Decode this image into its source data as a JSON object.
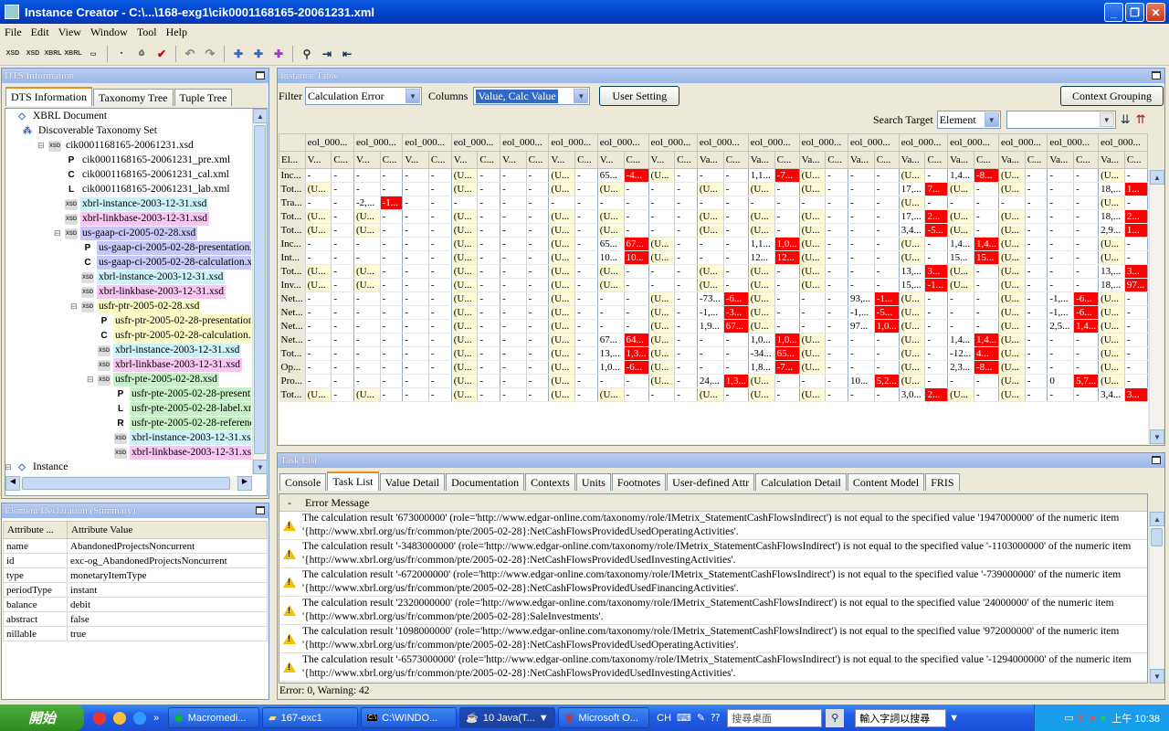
{
  "window": {
    "title": "Instance Creator - C:\\...\\168-exg1\\cik0001168165-20061231.xml"
  },
  "menu": [
    "File",
    "Edit",
    "View",
    "Window",
    "Tool",
    "Help"
  ],
  "dts": {
    "title": "DTS Information",
    "tabs": [
      "DTS Information",
      "Taxonomy Tree",
      "Tuple Tree"
    ],
    "tree": [
      {
        "label": "XBRL Document",
        "indent": 0,
        "icon": "X",
        "hl": ""
      },
      {
        "label": "Discoverable Taxonomy Set",
        "indent": 1,
        "icon": "T",
        "hl": ""
      },
      {
        "label": "cik0001168165-20061231.xsd",
        "indent": 2,
        "icon": "xsd",
        "hl": ""
      },
      {
        "label": "cik0001168165-20061231_pre.xml",
        "indent": 3,
        "icon": "P",
        "hl": ""
      },
      {
        "label": "cik0001168165-20061231_cal.xml",
        "indent": 3,
        "icon": "C",
        "hl": ""
      },
      {
        "label": "cik0001168165-20061231_lab.xml",
        "indent": 3,
        "icon": "L",
        "hl": ""
      },
      {
        "label": "xbrl-instance-2003-12-31.xsd",
        "indent": 3,
        "icon": "xsd",
        "hl": "cyan"
      },
      {
        "label": "xbrl-linkbase-2003-12-31.xsd",
        "indent": 3,
        "icon": "xsd",
        "hl": "pink"
      },
      {
        "label": "us-gaap-ci-2005-02-28.xsd",
        "indent": 3,
        "icon": "xsd",
        "hl": "blue"
      },
      {
        "label": "us-gaap-ci-2005-02-28-presentation.x",
        "indent": 4,
        "icon": "P",
        "hl": "blue"
      },
      {
        "label": "us-gaap-ci-2005-02-28-calculation.xr",
        "indent": 4,
        "icon": "C",
        "hl": "blue"
      },
      {
        "label": "xbrl-instance-2003-12-31.xsd",
        "indent": 4,
        "icon": "xsd",
        "hl": "cyan"
      },
      {
        "label": "xbrl-linkbase-2003-12-31.xsd",
        "indent": 4,
        "icon": "xsd",
        "hl": "pink"
      },
      {
        "label": "usfr-ptr-2005-02-28.xsd",
        "indent": 4,
        "icon": "xsd",
        "hl": "yellow"
      },
      {
        "label": "usfr-ptr-2005-02-28-presentation",
        "indent": 5,
        "icon": "P",
        "hl": "yellow"
      },
      {
        "label": "usfr-ptr-2005-02-28-calculation.x",
        "indent": 5,
        "icon": "C",
        "hl": "yellow"
      },
      {
        "label": "xbrl-instance-2003-12-31.xsd",
        "indent": 5,
        "icon": "xsd",
        "hl": "cyan"
      },
      {
        "label": "xbrl-linkbase-2003-12-31.xsd",
        "indent": 5,
        "icon": "xsd",
        "hl": "pink"
      },
      {
        "label": "usfr-pte-2005-02-28.xsd",
        "indent": 5,
        "icon": "xsd",
        "hl": "green"
      },
      {
        "label": "usfr-pte-2005-02-28-present",
        "indent": 6,
        "icon": "P",
        "hl": "green"
      },
      {
        "label": "usfr-pte-2005-02-28-label.xn",
        "indent": 6,
        "icon": "L",
        "hl": "green"
      },
      {
        "label": "usfr-pte-2005-02-28-referenc",
        "indent": 6,
        "icon": "R",
        "hl": "green"
      },
      {
        "label": "xbrl-instance-2003-12-31.xsd",
        "indent": 6,
        "icon": "xsd",
        "hl": "cyan"
      },
      {
        "label": "xbrl-linkbase-2003-12-31.xsd",
        "indent": 6,
        "icon": "xsd",
        "hl": "pink"
      },
      {
        "label": "Instance",
        "indent": 0,
        "icon": "X",
        "hl": ""
      }
    ]
  },
  "decl": {
    "title": "Element Declaration (Summary)",
    "col1": "Attribute ...",
    "col2": "Attribute Value",
    "rows": [
      [
        "name",
        "AbandonedProjectsNoncurrent"
      ],
      [
        "id",
        "exc-og_AbandonedProjectsNoncurrent"
      ],
      [
        "type",
        "monetaryItemType"
      ],
      [
        "periodType",
        "instant"
      ],
      [
        "balance",
        "debit"
      ],
      [
        "abstract",
        "false"
      ],
      [
        "nillable",
        "true"
      ]
    ]
  },
  "instance": {
    "title": "Instance Table",
    "filter_label": "Filter",
    "filter_value": "Calculation Error",
    "columns_label": "Columns",
    "columns_value": "Value, Calc Value",
    "user_setting": "User Setting",
    "context_grouping": "Context Grouping",
    "search_target_label": "Search Target",
    "search_target_value": "Element",
    "ctx_header": "eol_000...",
    "sub_v": "V...",
    "sub_c": "C...",
    "sub_va": "Va...",
    "el_header": "El...",
    "rows": [
      [
        "Inc...",
        "-|-",
        "-|-",
        "-|-",
        "(U...|-",
        "-|-",
        "(U...|-",
        "65...|-4...",
        "(U...|-",
        "-|-",
        "1,1...|-7...",
        "(U...|-",
        "-|-",
        "(U...|-",
        "1,4...|-8...",
        "(U...|-",
        "-|-",
        "(U...|-"
      ],
      [
        "Tot...",
        "(U...|-",
        "-|-",
        "-|-",
        "(U...|-",
        "-|-",
        "(U...|-",
        "(U...|-",
        "-|-",
        "(U...|-",
        "(U...|-",
        "(U...|-",
        "-|-",
        "17,...|7...",
        "(U...|-",
        "(U...|-",
        "-|-",
        "18,...|1..."
      ],
      [
        "Tra...",
        "-|-",
        "-2,...|-1...",
        "-|-",
        "-|-",
        "-|-",
        "-|-",
        "-|-",
        "-|-",
        "-|-",
        "-|-",
        "-|-",
        "-|-",
        "(U...|-",
        "-|-",
        "-|-",
        "-|-",
        "(U...|-"
      ],
      [
        "Tot...",
        "(U...|-",
        "(U...|-",
        "-|-",
        "(U...|-",
        "-|-",
        "(U...|-",
        "(U...|-",
        "-|-",
        "(U...|-",
        "(U...|-",
        "(U...|-",
        "-|-",
        "17,...|2...",
        "(U...|-",
        "(U...|-",
        "-|-",
        "18,...|2..."
      ],
      [
        "Tot...",
        "(U...|-",
        "(U...|-",
        "-|-",
        "(U...|-",
        "-|-",
        "(U...|-",
        "(U...|-",
        "-|-",
        "(U...|-",
        "(U...|-",
        "(U...|-",
        "-|-",
        "3,4...|-5...",
        "(U...|-",
        "(U...|-",
        "-|-",
        "2,9...|1..."
      ],
      [
        "Inc...",
        "-|-",
        "-|-",
        "-|-",
        "(U...|-",
        "-|-",
        "(U...|-",
        "65...|67...",
        "(U...|-",
        "-|-",
        "1,1...|1,0...",
        "(U...|-",
        "-|-",
        "(U...|-",
        "1,4...|1,4...",
        "(U...|-",
        "-|-",
        "(U...|-"
      ],
      [
        "Int...",
        "-|-",
        "-|-",
        "-|-",
        "(U...|-",
        "-|-",
        "(U...|-",
        "10...|10...",
        "(U...|-",
        "-|-",
        "12...|12...",
        "(U...|-",
        "-|-",
        "(U...|-",
        "15...|15...",
        "(U...|-",
        "-|-",
        "(U...|-"
      ],
      [
        "Tot...",
        "(U...|-",
        "(U...|-",
        "-|-",
        "(U...|-",
        "-|-",
        "(U...|-",
        "(U...|-",
        "-|-",
        "(U...|-",
        "(U...|-",
        "(U...|-",
        "-|-",
        "13,...|3...",
        "(U...|-",
        "(U...|-",
        "-|-",
        "13,...|3..."
      ],
      [
        "Inv...",
        "(U...|-",
        "(U...|-",
        "-|-",
        "(U...|-",
        "-|-",
        "(U...|-",
        "(U...|-",
        "-|-",
        "(U...|-",
        "(U...|-",
        "(U...|-",
        "-|-",
        "15,...|-1...",
        "(U...|-",
        "(U...|-",
        "-|-",
        "18,...|97..."
      ],
      [
        "Net...",
        "-|-",
        "-|-",
        "-|-",
        "(U...|-",
        "-|-",
        "(U...|-",
        "-|-",
        "(U...|-",
        "-73...|-6...",
        "(U...|-",
        "-|-",
        "93,...|-1...",
        "(U...|-",
        "-|-",
        "(U...|-",
        "-1,...|-6...",
        "(U...|-"
      ],
      [
        "Net...",
        "-|-",
        "-|-",
        "-|-",
        "(U...|-",
        "-|-",
        "(U...|-",
        "-|-",
        "(U...|-",
        "-1,...|-3...",
        "(U...|-",
        "-|-",
        "-1,...|-5...",
        "(U...|-",
        "-|-",
        "(U...|-",
        "-1,...|-6...",
        "(U...|-"
      ],
      [
        "Net...",
        "-|-",
        "-|-",
        "-|-",
        "(U...|-",
        "-|-",
        "(U...|-",
        "-|-",
        "(U...|-",
        "1,9...|67...",
        "(U...|-",
        "-|-",
        "97...|1,0...",
        "(U...|-",
        "-|-",
        "(U...|-",
        "2,5...|1,4...",
        "(U...|-"
      ],
      [
        "Net...",
        "-|-",
        "-|-",
        "-|-",
        "(U...|-",
        "-|-",
        "(U...|-",
        "67...|64...",
        "(U...|-",
        "-|-",
        "1,0...|1,0...",
        "(U...|-",
        "-|-",
        "(U...|-",
        "1,4...|1,4...",
        "(U...|-",
        "-|-",
        "(U...|-"
      ],
      [
        "Tot...",
        "-|-",
        "-|-",
        "-|-",
        "(U...|-",
        "-|-",
        "(U...|-",
        "13,...|1,3...",
        "(U...|-",
        "-|-",
        "-34...|65...",
        "(U...|-",
        "-|-",
        "(U...|-",
        "-12...|4...",
        "(U...|-",
        "-|-",
        "(U...|-"
      ],
      [
        "Op...",
        "-|-",
        "-|-",
        "-|-",
        "(U...|-",
        "-|-",
        "(U...|-",
        "1,0...|-6...",
        "(U...|-",
        "-|-",
        "1,8...|-7...",
        "(U...|-",
        "-|-",
        "(U...|-",
        "2,3...|-8...",
        "(U...|-",
        "-|-",
        "(U...|-"
      ],
      [
        "Pro...",
        "-|-",
        "-|-",
        "-|-",
        "(U...|-",
        "-|-",
        "(U...|-",
        "-|-",
        "(U...|-",
        "24,...|1,3...",
        "(U...|-",
        "-|-",
        "10...|5,2...",
        "(U...|-",
        "-|-",
        "(U...|-",
        "0|5,7...",
        "(U...|-"
      ],
      [
        "Tot...",
        "(U...|-",
        "(U...|-",
        "-|-",
        "(U...|-",
        "-|-",
        "(U...|-",
        "(U...|-",
        "-|-",
        "(U...|-",
        "(U...|-",
        "(U...|-",
        "-|-",
        "3,0...|2...",
        "(U...|-",
        "(U...|-",
        "-|-",
        "3,4...|3..."
      ]
    ]
  },
  "tasks": {
    "title": "Task List",
    "tabs": [
      "Console",
      "Task List",
      "Value Detail",
      "Documentation",
      "Contexts",
      "Units",
      "Footnotes",
      "User-defined Attr",
      "Calculation Detail",
      "Content Model",
      "FRIS"
    ],
    "col_header": "Error Message",
    "items": [
      "The calculation result '673000000' (role='http://www.edgar-online.com/taxonomy/role/IMetrix_StatementCashFlowsIndirect') is not equal to the specified value '1947000000' of the numeric item '{http://www.xbrl.org/us/fr/common/pte/2005-02-28}:NetCashFlowsProvidedUsedOperatingActivities'.",
      "The calculation result '-3483000000' (role='http://www.edgar-online.com/taxonomy/role/IMetrix_StatementCashFlowsIndirect') is not equal to the specified value '-1103000000' of the numeric item '{http://www.xbrl.org/us/fr/common/pte/2005-02-28}:NetCashFlowsProvidedUsedInvestingActivities'.",
      "The calculation result '-672000000' (role='http://www.edgar-online.com/taxonomy/role/IMetrix_StatementCashFlowsIndirect') is not equal to the specified value '-739000000' of the numeric item '{http://www.xbrl.org/us/fr/common/pte/2005-02-28}:NetCashFlowsProvidedUsedFinancingActivities'.",
      "The calculation result '2320000000' (role='http://www.edgar-online.com/taxonomy/role/IMetrix_StatementCashFlowsIndirect') is not equal to the specified value '24000000' of the numeric item '{http://www.xbrl.org/us/fr/common/pte/2005-02-28}:SaleInvestments'.",
      "The calculation result '1098000000' (role='http://www.edgar-online.com/taxonomy/role/IMetrix_StatementCashFlowsIndirect') is not equal to the specified value '972000000' of the numeric item '{http://www.xbrl.org/us/fr/common/pte/2005-02-28}:NetCashFlowsProvidedUsedOperatingActivities'.",
      "The calculation result '-6573000000' (role='http://www.edgar-online.com/taxonomy/role/IMetrix_StatementCashFlowsIndirect') is not equal to the specified value '-1294000000' of the numeric item '{http://www.xbrl.org/us/fr/common/pte/2005-02-28}:NetCashFlowsProvidedUsedInvestingActivities'."
    ],
    "status": "Error: 0, Warning: 42"
  },
  "taskbar": {
    "start": "開始",
    "tasks": [
      "Macromedi...",
      "167-exc1",
      "C:\\WINDO...",
      "10 Java(T...",
      "Microsoft O..."
    ],
    "lang": "CH",
    "search_placeholder": "搜尋桌面",
    "ime": "輸入字詞以搜尋",
    "clock": "上午 10:38"
  }
}
